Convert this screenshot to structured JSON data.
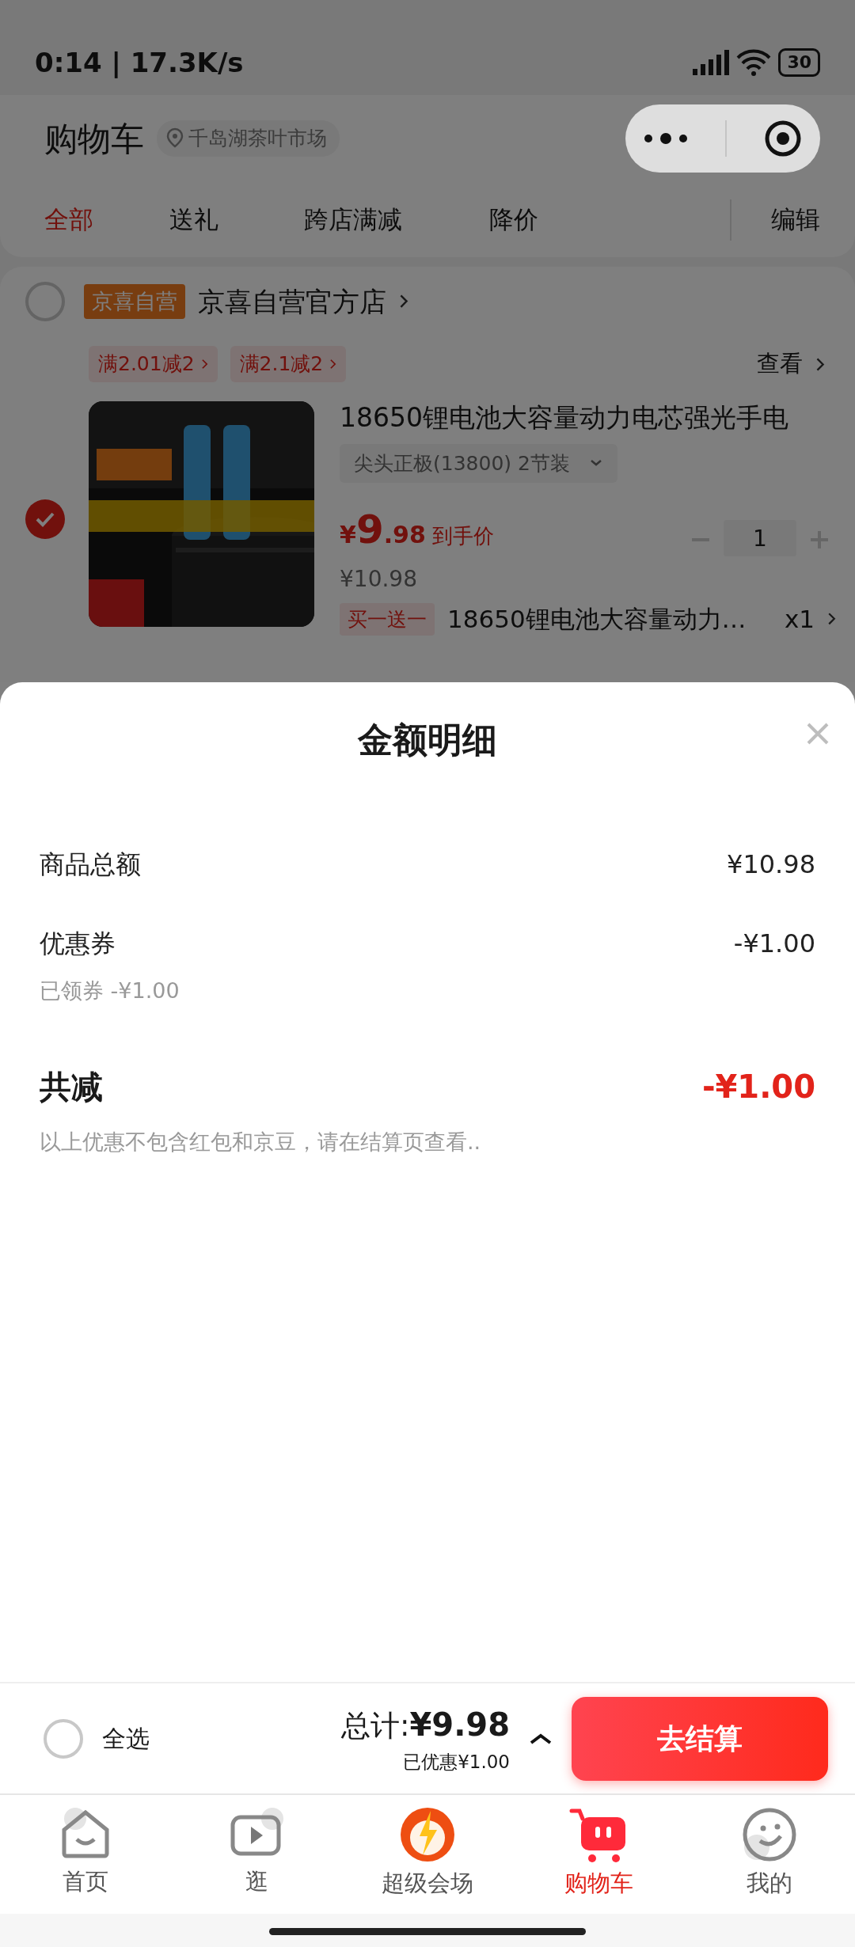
{
  "status_bar": {
    "time": "0:14 | 17.3K/s",
    "battery": "30"
  },
  "header": {
    "title": "购物车",
    "location": "千岛湖茶叶市场"
  },
  "filter_tabs": [
    {
      "label": "全部",
      "selected": true
    },
    {
      "label": "送礼",
      "selected": false
    },
    {
      "label": "跨店满减",
      "selected": false
    },
    {
      "label": "降价",
      "selected": false
    }
  ],
  "edit_button": "编辑",
  "store": {
    "checked": false,
    "tag": "京喜自营",
    "name": "京喜自营官方店",
    "promotions": [
      {
        "label": "满2.01减2"
      },
      {
        "label": "满2.1减2"
      }
    ],
    "view_link": "查看"
  },
  "product": {
    "checked": true,
    "title": "18650锂电池大容量动力电芯强光手电",
    "spec": "尖头正极(13800) 2节装",
    "price_currency": "¥",
    "price_integer": "9",
    "price_decimal": ".98",
    "price_note": "到手价",
    "original_price": "¥10.98",
    "quantity": "1",
    "gift": {
      "tag": "买一送一",
      "name": "18650锂电池大容量动力…",
      "count": "x1"
    }
  },
  "sheet": {
    "title": "金额明细",
    "rows": [
      {
        "label": "商品总额",
        "value": "¥10.98"
      },
      {
        "label": "优惠券",
        "value": "-¥1.00",
        "note": "已领券 -¥1.00"
      }
    ],
    "total": {
      "label": "共减",
      "value": "-¥1.00",
      "note": "以上优惠不包含红包和京豆，请在结算页查看.."
    }
  },
  "checkout_bar": {
    "select_all_checked": false,
    "select_all_label": "全选",
    "total_label": "总计:",
    "total_value": "¥9.98",
    "discount": "已优惠¥1.00",
    "button": "去结算"
  },
  "bottom_nav": [
    {
      "kind": "home",
      "label": "首页",
      "selected": false
    },
    {
      "kind": "video",
      "label": "逛",
      "selected": false
    },
    {
      "kind": "bolt",
      "label": "超级会场",
      "selected": false
    },
    {
      "kind": "cart",
      "label": "购物车",
      "selected": true
    },
    {
      "kind": "smile",
      "label": "我的",
      "selected": false
    }
  ]
}
